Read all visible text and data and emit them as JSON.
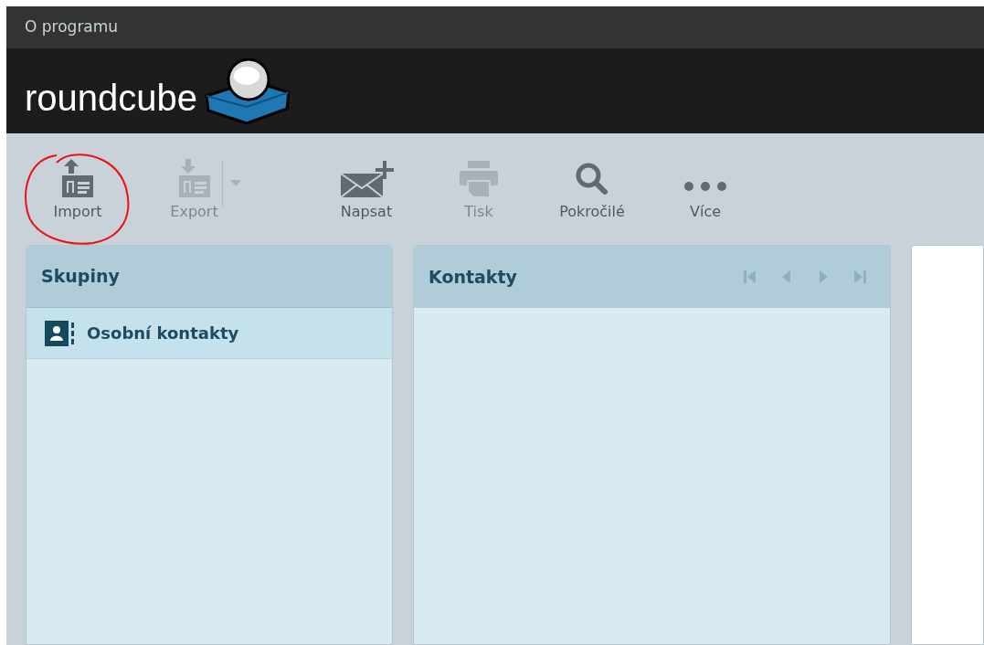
{
  "top_bar": {
    "link": "O programu"
  },
  "logo": {
    "text": "roundcube"
  },
  "toolbar": [
    {
      "kind": "import",
      "label": "Import",
      "disabled": false,
      "has_menu": false,
      "circled": true
    },
    {
      "kind": "export",
      "label": "Export",
      "disabled": true,
      "has_menu": true,
      "circled": false
    },
    {
      "kind": "compose",
      "label": "Napsat",
      "disabled": false,
      "has_menu": false,
      "circled": false
    },
    {
      "kind": "print",
      "label": "Tisk",
      "disabled": true,
      "has_menu": false,
      "circled": false
    },
    {
      "kind": "search",
      "label": "Pokročilé",
      "disabled": false,
      "has_menu": false,
      "circled": false
    },
    {
      "kind": "more",
      "label": "Více",
      "disabled": false,
      "has_menu": false,
      "circled": false
    }
  ],
  "groups_panel": {
    "title": "Skupiny",
    "items": [
      {
        "label": "Osobní kontakty",
        "selected": true
      }
    ]
  },
  "contacts_panel": {
    "title": "Kontakty",
    "pager": [
      {
        "kind": "first",
        "disabled": true
      },
      {
        "kind": "prev",
        "disabled": true
      },
      {
        "kind": "next",
        "disabled": true
      },
      {
        "kind": "last",
        "disabled": true
      }
    ]
  }
}
